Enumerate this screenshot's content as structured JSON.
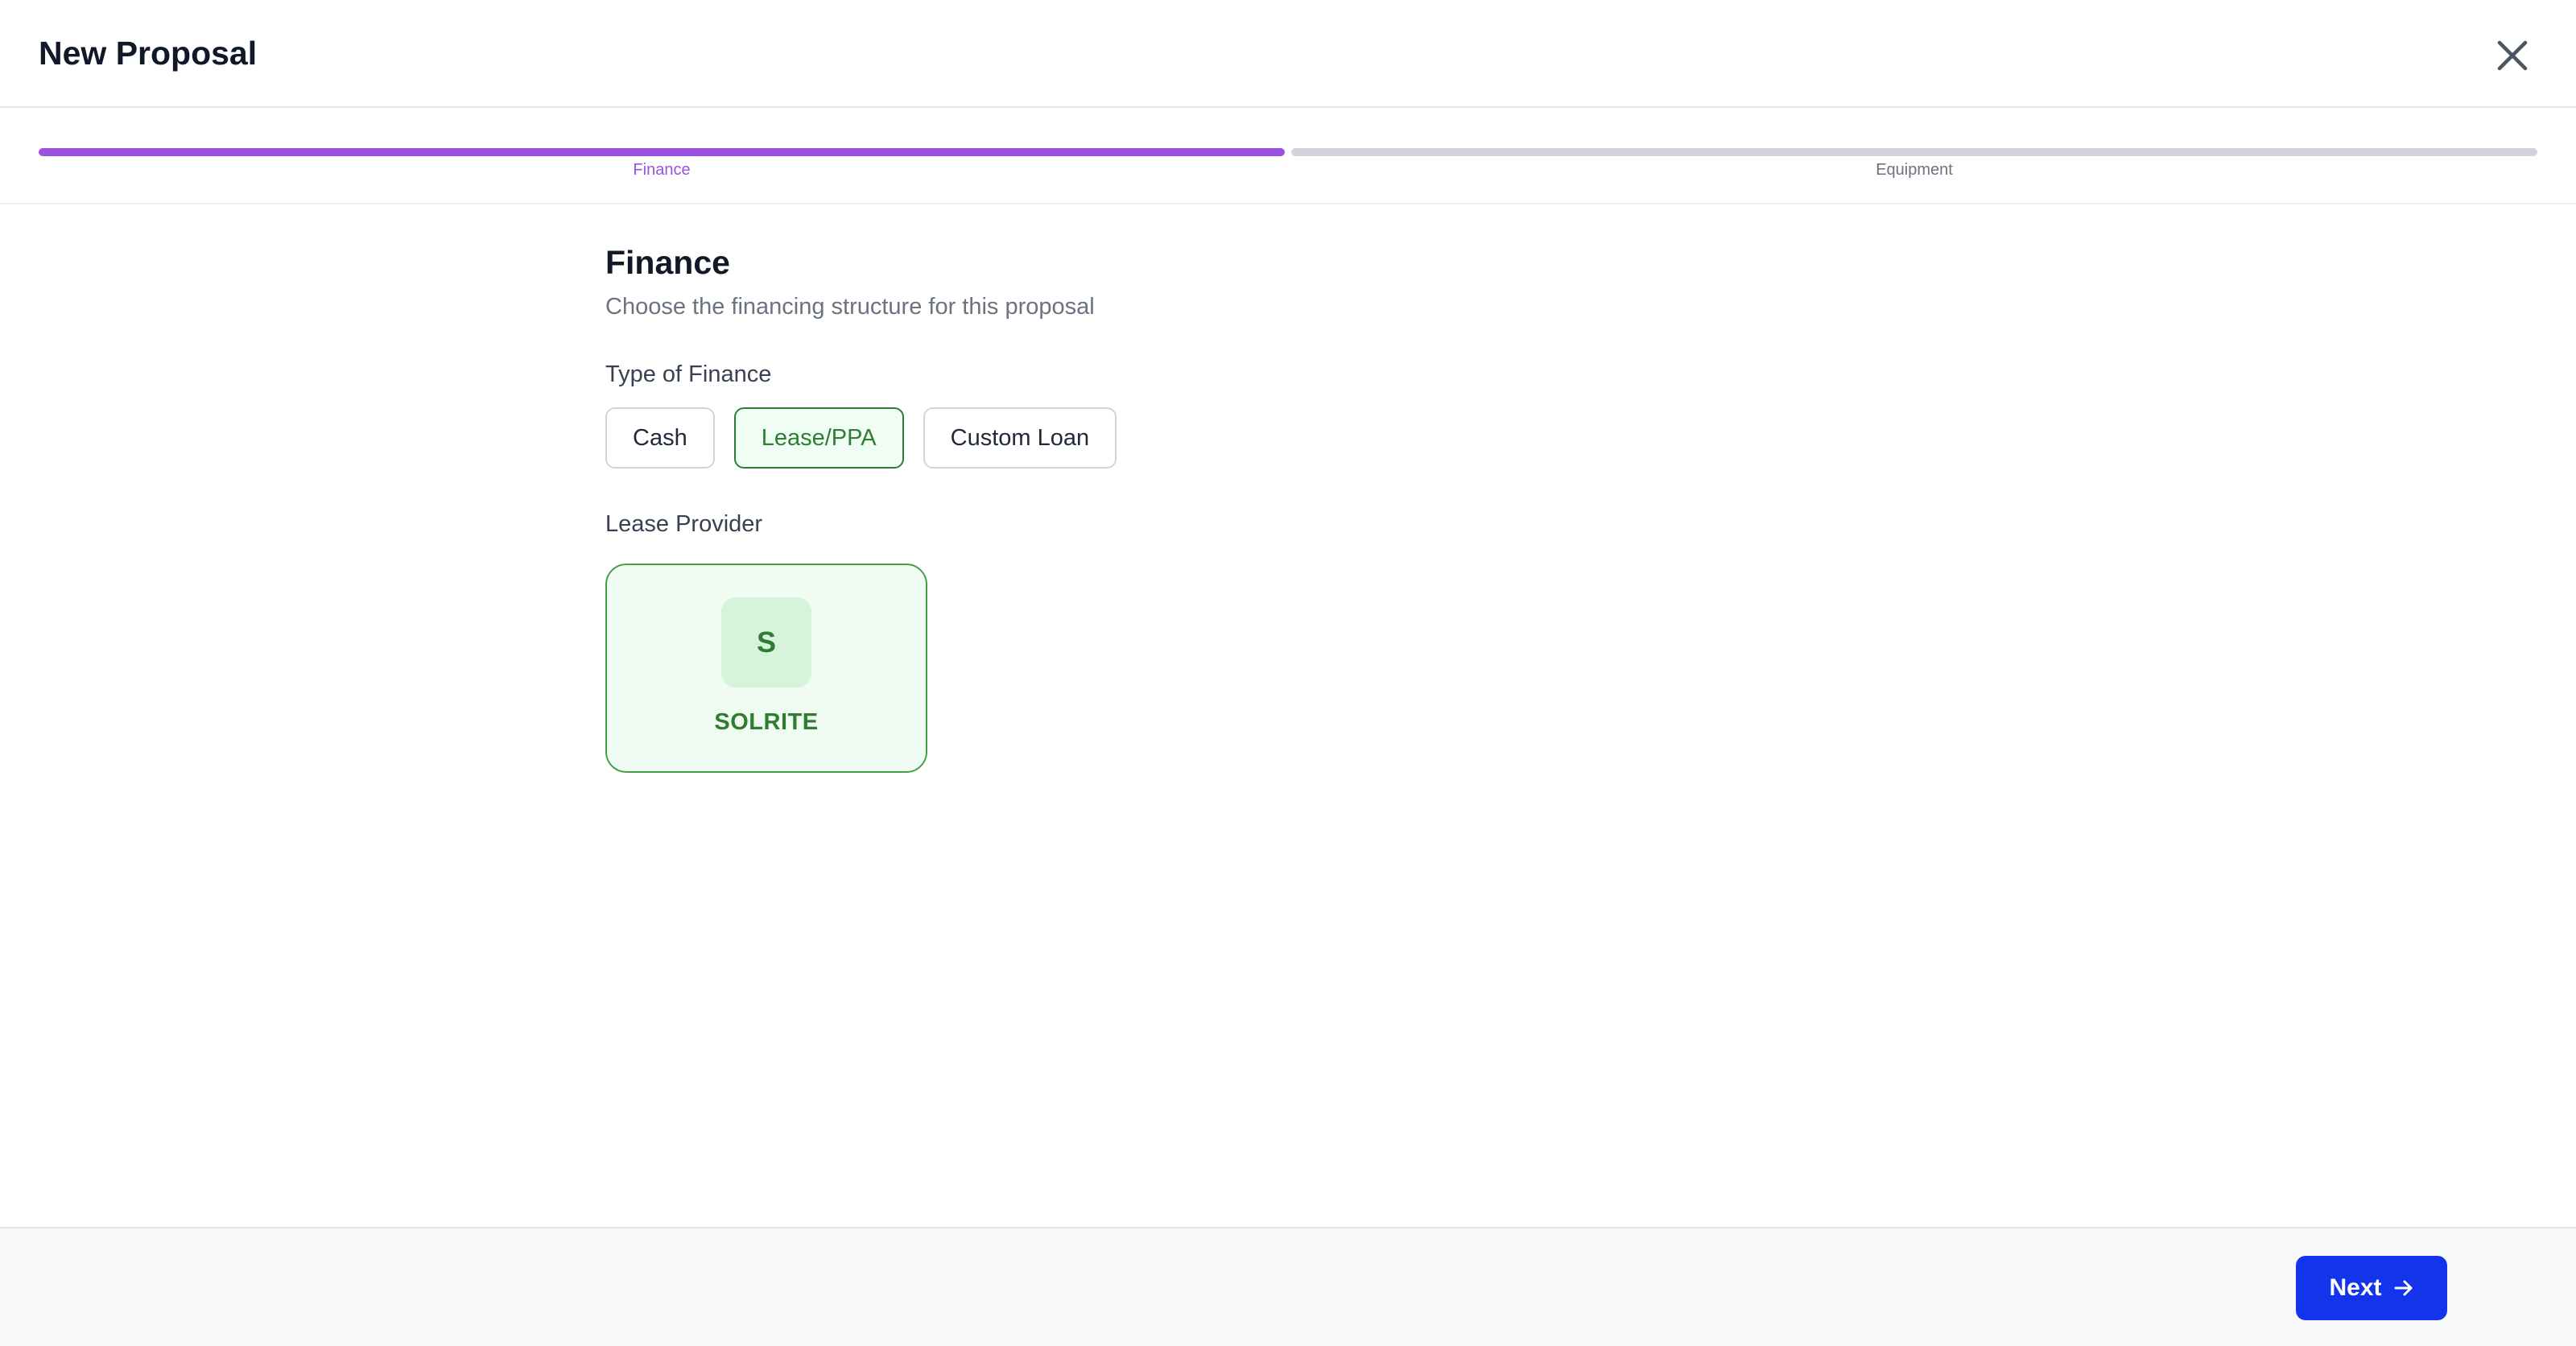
{
  "header": {
    "title": "New Proposal",
    "close_icon": "close-icon"
  },
  "stepper": {
    "steps": [
      {
        "label": "Finance",
        "state": "active",
        "color": "#9b51e0",
        "progress": 1.0
      },
      {
        "label": "Equipment",
        "state": "inactive",
        "color": "#d1d5db",
        "progress": 0.0
      }
    ]
  },
  "main": {
    "title": "Finance",
    "subtitle": "Choose the financing structure for this proposal",
    "type_label": "Type of Finance",
    "finance_types": [
      {
        "label": "Cash",
        "selected": false
      },
      {
        "label": "Lease/PPA",
        "selected": true
      },
      {
        "label": "Custom Loan",
        "selected": false
      }
    ],
    "provider_label": "Lease Provider",
    "providers": [
      {
        "initial": "S",
        "name": "SOLRITE",
        "selected": true
      }
    ]
  },
  "footer": {
    "next_label": "Next",
    "next_icon": "arrow-right-icon",
    "accent": "#1434eb"
  },
  "colors": {
    "selected_green": "#2e7d32",
    "progress_active": "#9b51e0",
    "progress_inactive": "#d1d5db"
  }
}
